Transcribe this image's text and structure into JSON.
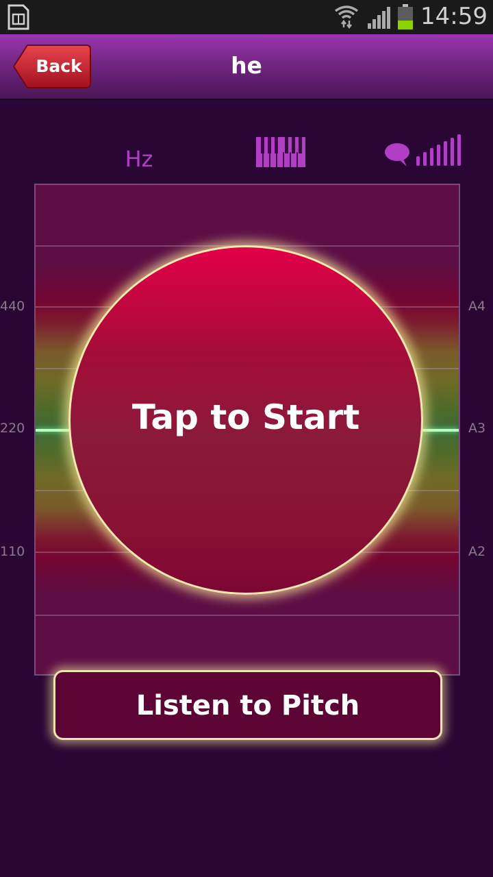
{
  "status_bar": {
    "time": "14:59",
    "icons": [
      "sim-card-icon",
      "wifi-icon",
      "signal-icon",
      "battery-icon"
    ]
  },
  "header": {
    "back_label": "Back",
    "title": "he"
  },
  "modes": {
    "hz_label": "Hz",
    "icons": [
      "piano-keys-icon",
      "speech-bubble-icon",
      "volume-bars-icon"
    ]
  },
  "graph": {
    "left_axis": [
      "440",
      "220",
      "110"
    ],
    "right_axis": [
      "A4",
      "A3",
      "A2"
    ]
  },
  "start_button": {
    "label": "Tap to Start"
  },
  "listen_button": {
    "label": "Listen to Pitch"
  },
  "colors": {
    "header_top": "#9b35b0",
    "background": "#2a0634",
    "accent_purple": "#b23ec6",
    "start_red": "#e20049",
    "glow": "#f4e7b0"
  }
}
